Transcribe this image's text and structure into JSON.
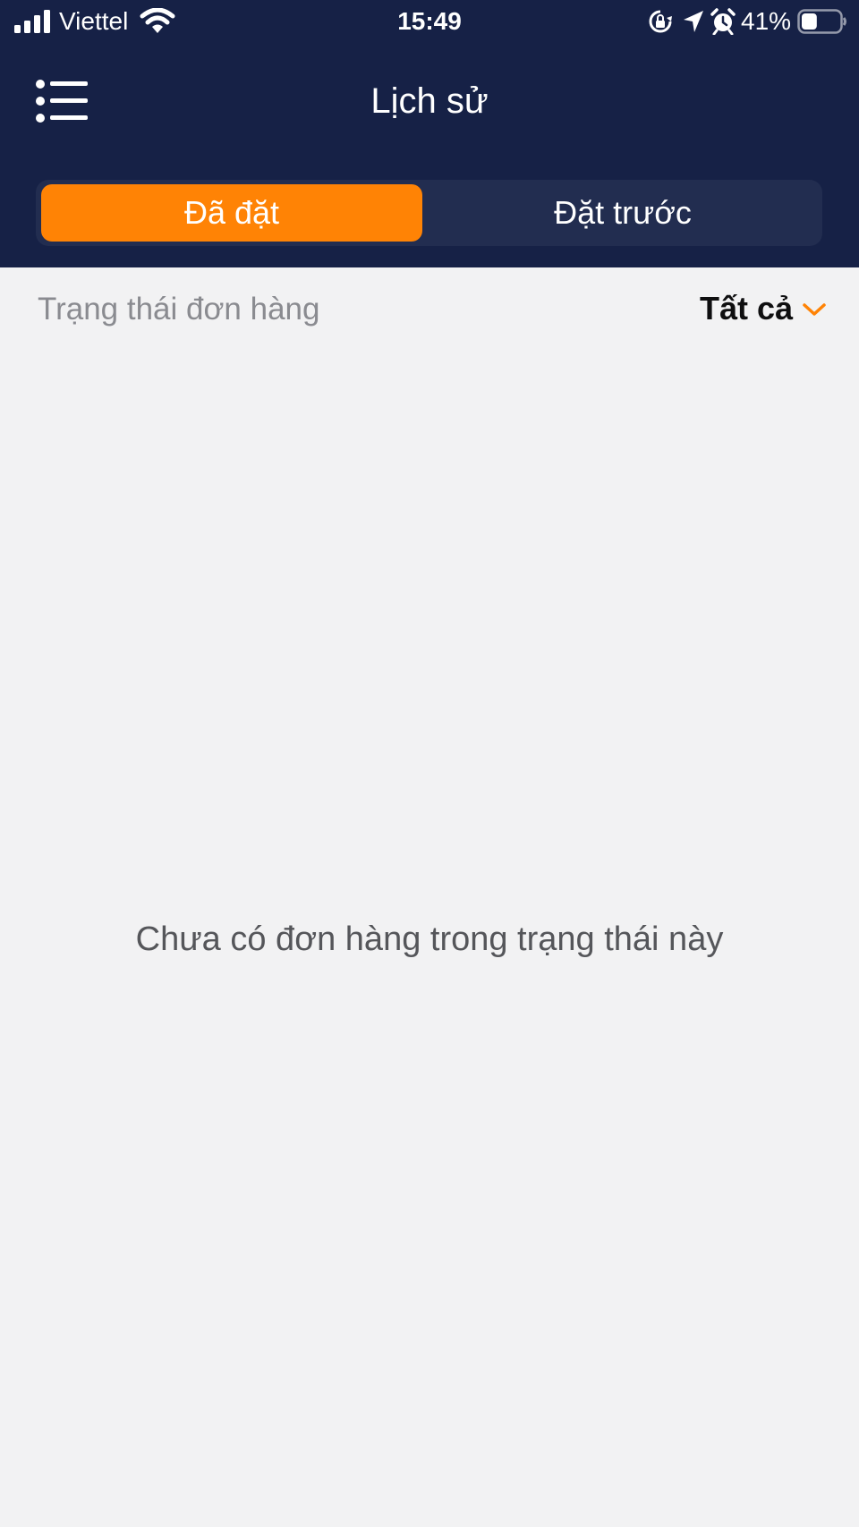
{
  "status_bar": {
    "carrier": "Viettel",
    "time": "15:49",
    "battery_percent": "41%",
    "battery_level": 0.41,
    "icons": [
      "signal-icon",
      "wifi-icon",
      "lock-rotation-icon",
      "location-icon",
      "alarm-icon",
      "battery-icon"
    ]
  },
  "header": {
    "title": "Lịch sử",
    "menu_icon": "hamburger-menu-icon"
  },
  "tabs": [
    {
      "label": "Đã đặt",
      "active": true
    },
    {
      "label": "Đặt trước",
      "active": false
    }
  ],
  "filter": {
    "label": "Trạng thái đơn hàng",
    "selected": "Tất cả",
    "dropdown_icon": "chevron-down-icon"
  },
  "empty_state": {
    "message": "Chưa có đơn hàng trong trạng thái này"
  },
  "colors": {
    "header_bg": "#162146",
    "segment_bg": "#222d50",
    "accent": "#ff8305",
    "page_bg": "#f2f2f3"
  }
}
